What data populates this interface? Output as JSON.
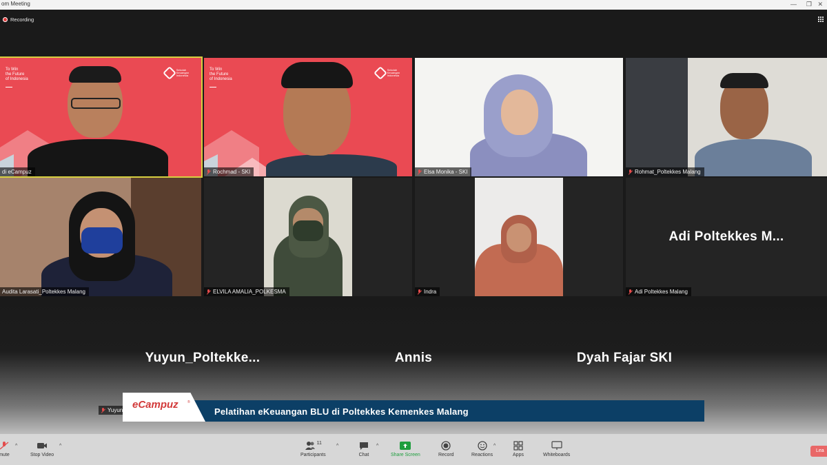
{
  "window": {
    "title": "om Meeting"
  },
  "topbar": {
    "recording_label": "Recording"
  },
  "tiles": [
    {
      "name": "di eCampuz",
      "slide_text": "To Win\nthe Future\nof Indonesia",
      "logo_text": "Sekolah\nKeuangan\nIndonesia"
    },
    {
      "name": "Rochmad - SKI",
      "slide_text": "To Win\nthe Future\nof Indonesia",
      "logo_text": "Sekolah\nKeuangan\nIndonesia"
    },
    {
      "name": "Elsa Monika - SKI"
    },
    {
      "name": "Rohmat_Poltekkes Malang"
    },
    {
      "name": "Audita Larasati_Poltekkes Malang"
    },
    {
      "name": "ELVILA AMALIA_POLKESMA"
    },
    {
      "name": "Indra"
    },
    {
      "name": "Adi Poltekkes Malang",
      "big_name": "Adi Poltekkes M..."
    },
    {
      "name": "Yuyun",
      "big_name": "Yuyun_Poltekke..."
    },
    {
      "big_name": "Annis"
    },
    {
      "big_name": "Dyah Fajar SKI"
    }
  ],
  "banner": {
    "logo": "eCampuz",
    "logo_mark": "®",
    "text": "Pelatihan eKeuangan BLU di Poltekkes Kemenkes Malang"
  },
  "toolbar": {
    "unmute": "mute",
    "stop_video": "Stop Video",
    "participants": "Participants",
    "participants_count": "11",
    "chat": "Chat",
    "share_screen": "Share Screen",
    "record": "Record",
    "reactions": "Reactions",
    "apps": "Apps",
    "whiteboards": "Whiteboards",
    "leave": "Lea"
  },
  "colors": {
    "active_speaker": "#d7d040",
    "slide_red": "#ea4a53",
    "banner_blue": "#0c3f66",
    "share_green": "#1e9e3e"
  }
}
